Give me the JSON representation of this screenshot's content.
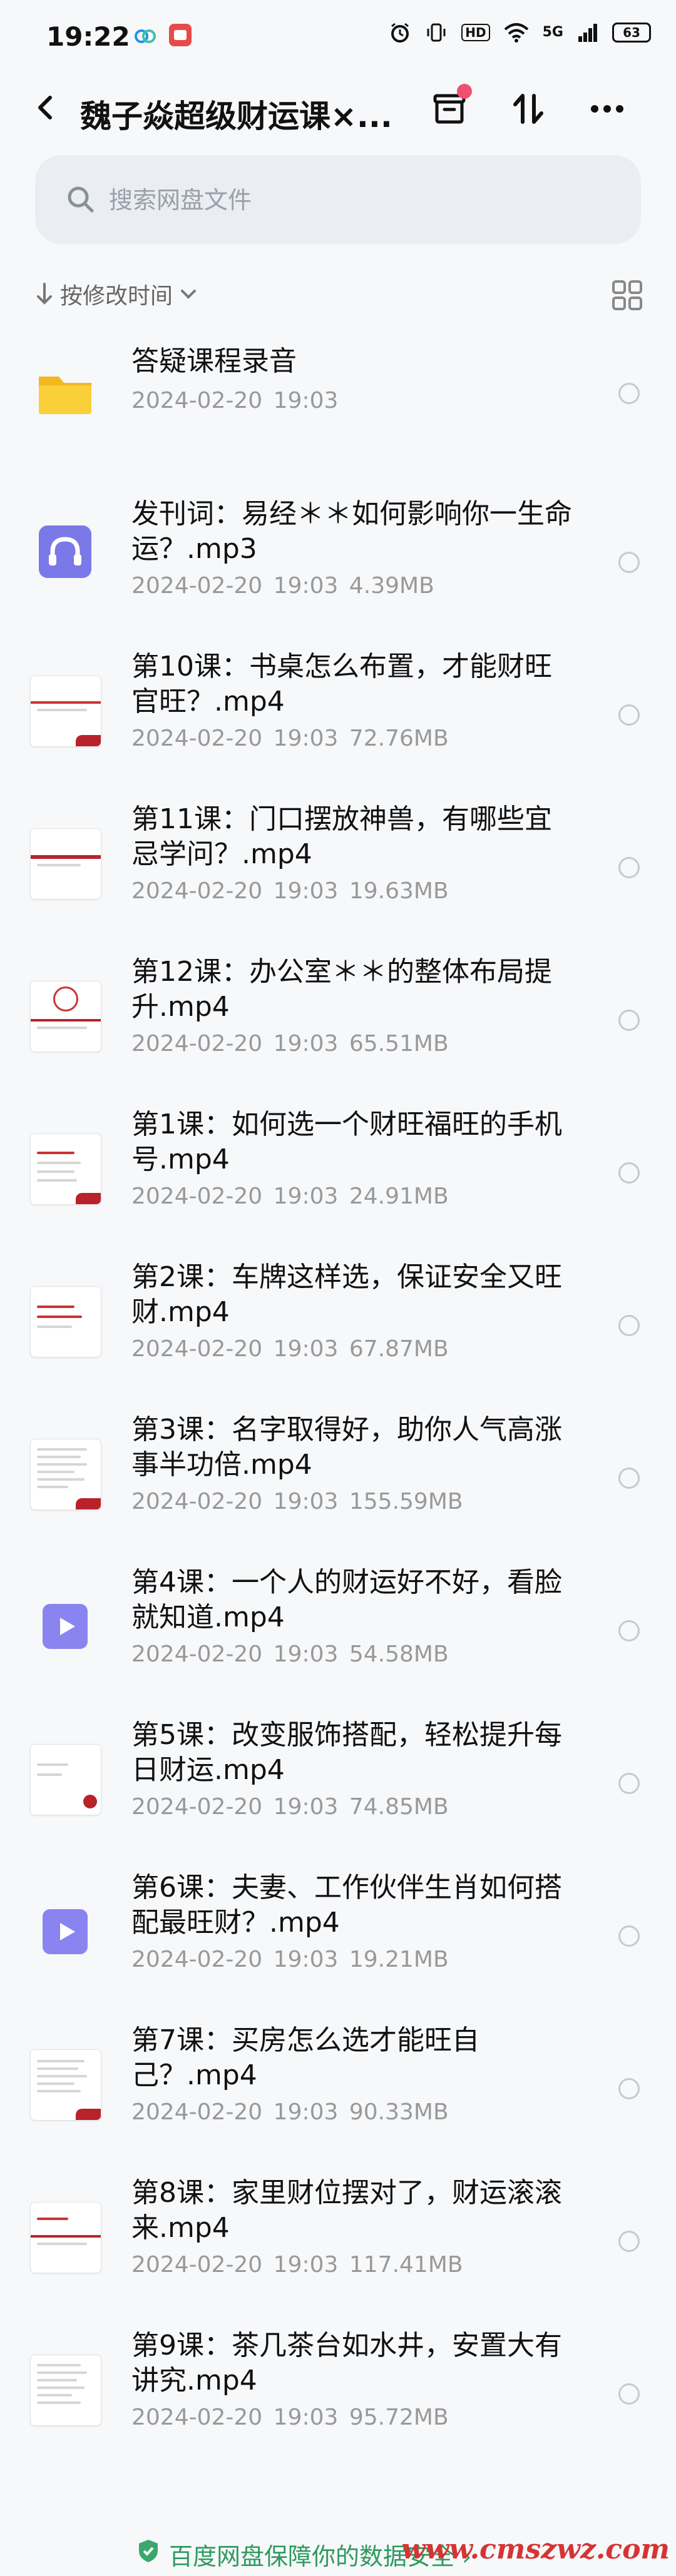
{
  "status": {
    "time": "19:22",
    "network": "5G",
    "battery": "63"
  },
  "header": {
    "title": "魏子焱超级财运课×..."
  },
  "search": {
    "placeholder": "搜索网盘文件"
  },
  "sort": {
    "label": "按修改时间"
  },
  "files": [
    {
      "name": "答疑课程录音",
      "date": "2024-02-20",
      "time": "19:03",
      "size": "",
      "type": "folder"
    },
    {
      "name": "发刊词：易经＊＊如何影响你一生命运？.mp3",
      "date": "2024-02-20",
      "time": "19:03",
      "size": "4.39MB",
      "type": "audio"
    },
    {
      "name": "第10课：书桌怎么布置，才能财旺官旺？.mp4",
      "date": "2024-02-20",
      "time": "19:03",
      "size": "72.76MB",
      "type": "doc"
    },
    {
      "name": "第11课：门口摆放神兽，有哪些宜忌学问？.mp4",
      "date": "2024-02-20",
      "time": "19:03",
      "size": "19.63MB",
      "type": "doc"
    },
    {
      "name": "第12课：办公室＊＊的整体布局提升.mp4",
      "date": "2024-02-20",
      "time": "19:03",
      "size": "65.51MB",
      "type": "doc"
    },
    {
      "name": "第1课：如何选一个财旺福旺的手机号.mp4",
      "date": "2024-02-20",
      "time": "19:03",
      "size": "24.91MB",
      "type": "doc"
    },
    {
      "name": "第2课：车牌这样选，保证安全又旺财.mp4",
      "date": "2024-02-20",
      "time": "19:03",
      "size": "67.87MB",
      "type": "doc"
    },
    {
      "name": "第3课：名字取得好，助你人气高涨事半功倍.mp4",
      "date": "2024-02-20",
      "time": "19:03",
      "size": "155.59MB",
      "type": "doc"
    },
    {
      "name": "第4课：一个人的财运好不好，看脸就知道.mp4",
      "date": "2024-02-20",
      "time": "19:03",
      "size": "54.58MB",
      "type": "video"
    },
    {
      "name": "第5课：改变服饰搭配，轻松提升每日财运.mp4",
      "date": "2024-02-20",
      "time": "19:03",
      "size": "74.85MB",
      "type": "doc"
    },
    {
      "name": "第6课：夫妻、工作伙伴生肖如何搭配最旺财？.mp4",
      "date": "2024-02-20",
      "time": "19:03",
      "size": "19.21MB",
      "type": "video"
    },
    {
      "name": "第7课：买房怎么选才能旺自己？.mp4",
      "date": "2024-02-20",
      "time": "19:03",
      "size": "90.33MB",
      "type": "doc"
    },
    {
      "name": "第8课：家里财位摆对了，财运滚滚来.mp4",
      "date": "2024-02-20",
      "time": "19:03",
      "size": "117.41MB",
      "type": "doc"
    },
    {
      "name": "第9课：茶几茶台如水井，安置大有讲究.mp4",
      "date": "2024-02-20",
      "time": "19:03",
      "size": "95.72MB",
      "type": "doc"
    }
  ],
  "footer": {
    "text": "百度网盘保障你的数据安全 ›",
    "brand": "www.cmszwz.com"
  },
  "colors": {
    "accent_green": "#2e9a5e",
    "folder_yellow": "#f7c325",
    "video_purple": "#8a84f0",
    "notify_red": "#f0506e"
  }
}
